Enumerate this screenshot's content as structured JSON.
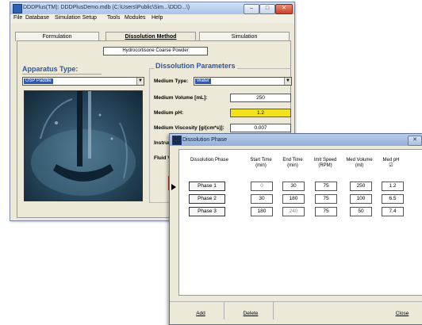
{
  "main_window": {
    "title": "DDDPlus(TM): DDDPlusDemo.mdb (C:\\Users\\Public\\Sim...\\DDD...\\)",
    "controls": {
      "minimize": "‒",
      "maximize": "□",
      "close": "✕"
    },
    "menu": [
      "File",
      "Database",
      "Simulation Setup",
      "Tools",
      "Modules",
      "Help"
    ],
    "tabs": [
      "Formulation",
      "Dissolution Method",
      "Simulation"
    ],
    "active_tab": "Dissolution Method",
    "product_label": "Hydrocortisone Coarse Powder",
    "apparatus_label": "Apparatus Type:",
    "apparatus_value": "USP Paddle",
    "dissolution_params_title": "Dissolution Parameters",
    "medium_type_label": "Medium Type:",
    "medium_type_value": "Water",
    "params": [
      {
        "label": "Medium Volume [mL]:",
        "value": "250",
        "highlight": false
      },
      {
        "label": "Medium pH:",
        "value": "1.2",
        "highlight": true
      },
      {
        "label": "Medium Viscosity [g/(cm*s)]:",
        "value": "0.007",
        "highlight": false
      },
      {
        "label": "Instrume",
        "value": "",
        "highlight": false
      },
      {
        "label": "Fluid Vol",
        "value": "",
        "highlight": false
      }
    ],
    "highlight_color": "#f2e21e",
    "accent_color": "#2a55a8"
  },
  "dialog": {
    "title": "Dissolution Phase",
    "close_glyph": "✕",
    "columns": [
      {
        "line1": "Dissolution Phase",
        "line2": ""
      },
      {
        "line1": "Start Time",
        "line2": "(min)"
      },
      {
        "line1": "End Time",
        "line2": "(min)"
      },
      {
        "line1": "Imit Speed",
        "line2": "(RPM)"
      },
      {
        "line1": "Med Volume",
        "line2": "(ml)"
      },
      {
        "line1": "Med pH",
        "line2": "☑"
      }
    ],
    "rows": [
      {
        "phase": "Phase 1",
        "start": "0",
        "end": "30",
        "speed": "75",
        "volume": "250",
        "ph": "1.2"
      },
      {
        "phase": "Phase 2",
        "start": "30",
        "end": "180",
        "speed": "75",
        "volume": "100",
        "ph": "6.5"
      },
      {
        "phase": "Phase 3",
        "start": "180",
        "end": "240",
        "speed": "75",
        "volume": "50",
        "ph": "7.4"
      }
    ],
    "buttons": {
      "add": "Add",
      "delete": "Delete",
      "close": "Close"
    }
  }
}
